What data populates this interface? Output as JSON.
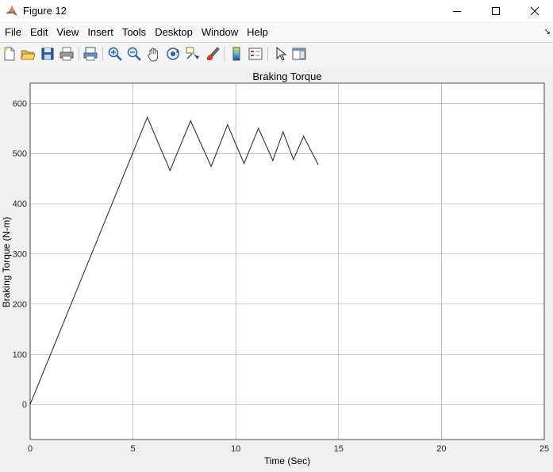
{
  "window": {
    "title": "Figure 12"
  },
  "menu": [
    "File",
    "Edit",
    "View",
    "Insert",
    "Tools",
    "Desktop",
    "Window",
    "Help"
  ],
  "toolbar_icons": [
    "new-figure-icon",
    "open-file-icon",
    "save-icon",
    "print-icon",
    "print-preview-icon",
    "zoom-in-icon",
    "zoom-out-icon",
    "pan-icon",
    "rotate-3d-icon",
    "data-cursor-icon",
    "brush-icon",
    "colorbar-icon",
    "legend-icon",
    "edit-plot-icon",
    "property-inspector-icon"
  ],
  "chart_data": {
    "type": "line",
    "title": "Braking Torque",
    "xlabel": "Time (Sec)",
    "ylabel": "Braking Torque (N-m)",
    "xlim": [
      0,
      25
    ],
    "ylim": [
      -70,
      640
    ],
    "xticks": [
      0,
      5,
      10,
      15,
      20,
      25
    ],
    "yticks": [
      0,
      100,
      200,
      300,
      400,
      500,
      600
    ],
    "grid": true,
    "series": [
      {
        "color": "#333333",
        "x": [
          0,
          5.7,
          6.8,
          7.8,
          8.8,
          9.6,
          10.4,
          11.1,
          11.8,
          12.3,
          12.8,
          13.3,
          14.0
        ],
        "y": [
          0,
          572,
          466,
          565,
          474,
          557,
          480,
          550,
          486,
          543,
          488,
          534,
          478
        ]
      }
    ]
  }
}
